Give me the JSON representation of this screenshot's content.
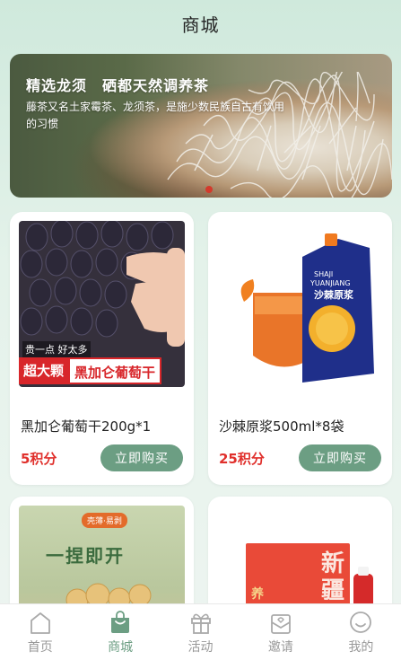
{
  "header": {
    "title": "商城"
  },
  "banner": {
    "title": "精选龙须　硒都天然调养茶",
    "description": "藤茶又名土家霉茶、龙须茶，是施少数民族自古有饮用的习惯"
  },
  "products": [
    {
      "name": "黑加仑葡萄干200g*1",
      "price": "5积分",
      "buy_label": "立即购买",
      "image_tags": [
        "贵一点 好太多",
        "超大颗",
        "黑加仑葡萄干"
      ]
    },
    {
      "name": "沙棘原浆500ml*8袋",
      "price": "25积分",
      "buy_label": "立即购买",
      "image_tags": [
        "SHAJI YUANJIANG",
        "沙棘原浆"
      ]
    },
    {
      "name": "",
      "price": "",
      "buy_label": "",
      "image_tags": [
        "一捏即开",
        "壳薄·易剥"
      ]
    },
    {
      "name": "",
      "price": "",
      "buy_label": "",
      "image_tags": [
        "新疆",
        "养"
      ]
    }
  ],
  "tabbar": {
    "items": [
      {
        "label": "首页",
        "icon": "home-icon"
      },
      {
        "label": "商城",
        "icon": "shopping-bag-icon",
        "active": true
      },
      {
        "label": "活动",
        "icon": "gift-icon"
      },
      {
        "label": "邀请",
        "icon": "invite-envelope-icon"
      },
      {
        "label": "我的",
        "icon": "profile-smile-icon"
      }
    ]
  },
  "colors": {
    "accent": "#6c9e83",
    "price": "#e0302c",
    "background": "#e4f2ea"
  }
}
